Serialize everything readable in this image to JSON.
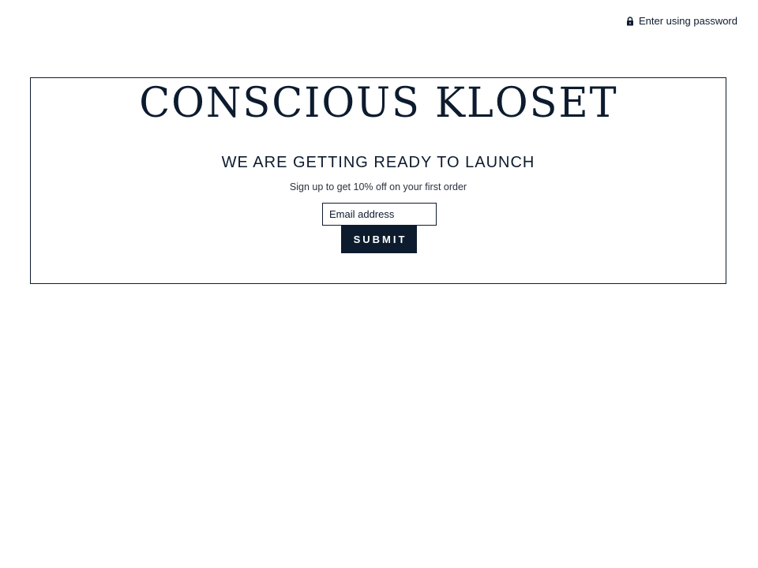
{
  "header": {
    "password_link_label": "Enter using password",
    "password_icon": "lock-icon"
  },
  "hero": {
    "logo_text": "CONSCIOUS KLOSET",
    "headline": "WE ARE GETTING READY TO LAUNCH",
    "subtext": "Sign up to get 10% off on your first order"
  },
  "signup": {
    "email_placeholder": "Email address",
    "submit_label": "SUBMIT"
  },
  "colors": {
    "brand": "#0d1b2e",
    "background": "#ffffff"
  }
}
